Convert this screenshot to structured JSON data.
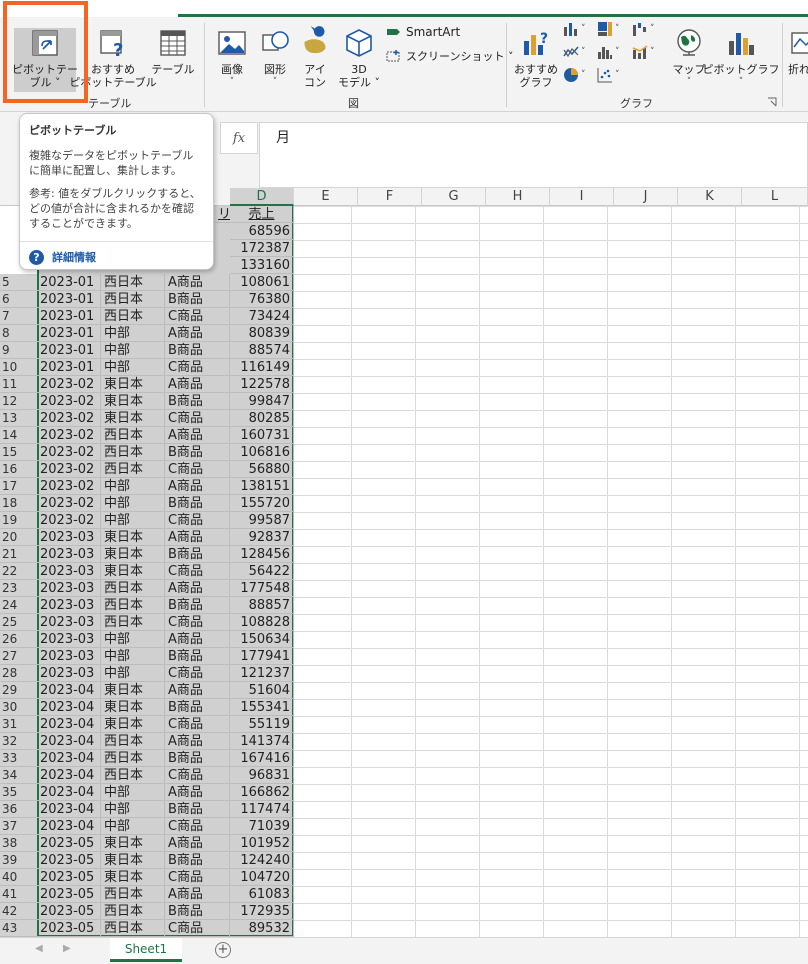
{
  "ribbon": {
    "pivot_label1": "ピボットテー",
    "pivot_label2": "ブル ˅",
    "recommended_pivot1": "おすすめ",
    "recommended_pivot2": "ピボットテーブル",
    "table": "テーブル",
    "tables_group": "テーブル",
    "image1": "画像",
    "image2": "˅",
    "shapes1": "図形",
    "shapes2": "˅",
    "icons1": "アイ",
    "icons2": "コン",
    "model3d1": "3D",
    "model3d2": "モデル ˅",
    "smartart": "SmartArt",
    "screenshot": "スクリーンショット ˅",
    "illustrations_group": "図",
    "rec_charts1": "おすすめ",
    "rec_charts2": "グラフ",
    "maps1": "マップ",
    "maps2": "˅",
    "pivotchart1": "ピボットグラフ",
    "pivotchart2": "˅",
    "charts_group": "グラフ",
    "sparkline": "折れ"
  },
  "formula": {
    "fx": "fx",
    "value": "月"
  },
  "tooltip": {
    "title": "ピボットテーブル",
    "desc1": "複雑なデータをピボットテーブルに簡単に配置し、集計します。",
    "desc2": "参考: 値をダブルクリックすると、どの値が合計に含まれるかを確認することができます。",
    "more": "詳細情報"
  },
  "columns": [
    "D",
    "E",
    "F",
    "G",
    "H",
    "I",
    "J",
    "K",
    "L"
  ],
  "header_partial": {
    "c": "リ",
    "d": "売上"
  },
  "partial_values": [
    "68596",
    "172387",
    "133160"
  ],
  "rows": [
    [
      "5",
      "2023-01",
      "西日本",
      "A商品",
      "108061"
    ],
    [
      "6",
      "2023-01",
      "西日本",
      "B商品",
      "76380"
    ],
    [
      "7",
      "2023-01",
      "西日本",
      "C商品",
      "73424"
    ],
    [
      "8",
      "2023-01",
      "中部",
      "A商品",
      "80839"
    ],
    [
      "9",
      "2023-01",
      "中部",
      "B商品",
      "88574"
    ],
    [
      "10",
      "2023-01",
      "中部",
      "C商品",
      "116149"
    ],
    [
      "11",
      "2023-02",
      "東日本",
      "A商品",
      "122578"
    ],
    [
      "12",
      "2023-02",
      "東日本",
      "B商品",
      "99847"
    ],
    [
      "13",
      "2023-02",
      "東日本",
      "C商品",
      "80285"
    ],
    [
      "14",
      "2023-02",
      "西日本",
      "A商品",
      "160731"
    ],
    [
      "15",
      "2023-02",
      "西日本",
      "B商品",
      "106816"
    ],
    [
      "16",
      "2023-02",
      "西日本",
      "C商品",
      "56880"
    ],
    [
      "17",
      "2023-02",
      "中部",
      "A商品",
      "138151"
    ],
    [
      "18",
      "2023-02",
      "中部",
      "B商品",
      "155720"
    ],
    [
      "19",
      "2023-02",
      "中部",
      "C商品",
      "99587"
    ],
    [
      "20",
      "2023-03",
      "東日本",
      "A商品",
      "92837"
    ],
    [
      "21",
      "2023-03",
      "東日本",
      "B商品",
      "128456"
    ],
    [
      "22",
      "2023-03",
      "東日本",
      "C商品",
      "56422"
    ],
    [
      "23",
      "2023-03",
      "西日本",
      "A商品",
      "177548"
    ],
    [
      "24",
      "2023-03",
      "西日本",
      "B商品",
      "88857"
    ],
    [
      "25",
      "2023-03",
      "西日本",
      "C商品",
      "108828"
    ],
    [
      "26",
      "2023-03",
      "中部",
      "A商品",
      "150634"
    ],
    [
      "27",
      "2023-03",
      "中部",
      "B商品",
      "177941"
    ],
    [
      "28",
      "2023-03",
      "中部",
      "C商品",
      "121237"
    ],
    [
      "29",
      "2023-04",
      "東日本",
      "A商品",
      "51604"
    ],
    [
      "30",
      "2023-04",
      "東日本",
      "B商品",
      "155341"
    ],
    [
      "31",
      "2023-04",
      "東日本",
      "C商品",
      "55119"
    ],
    [
      "32",
      "2023-04",
      "西日本",
      "A商品",
      "141374"
    ],
    [
      "33",
      "2023-04",
      "西日本",
      "B商品",
      "167416"
    ],
    [
      "34",
      "2023-04",
      "西日本",
      "C商品",
      "96831"
    ],
    [
      "35",
      "2023-04",
      "中部",
      "A商品",
      "166862"
    ],
    [
      "36",
      "2023-04",
      "中部",
      "B商品",
      "117474"
    ],
    [
      "37",
      "2023-04",
      "中部",
      "C商品",
      "71039"
    ],
    [
      "38",
      "2023-05",
      "東日本",
      "A商品",
      "101952"
    ],
    [
      "39",
      "2023-05",
      "東日本",
      "B商品",
      "124240"
    ],
    [
      "40",
      "2023-05",
      "東日本",
      "C商品",
      "104720"
    ],
    [
      "41",
      "2023-05",
      "西日本",
      "A商品",
      "61083"
    ],
    [
      "42",
      "2023-05",
      "西日本",
      "B商品",
      "172935"
    ],
    [
      "43",
      "2023-05",
      "西日本",
      "C商品",
      "89532"
    ]
  ],
  "sheet": {
    "tab": "Sheet1",
    "add": "+",
    "prev": "◀",
    "next": "▶"
  },
  "colors": {
    "accent": "#217346",
    "highlight_box": "#f26522",
    "link": "#1f5aa8"
  }
}
